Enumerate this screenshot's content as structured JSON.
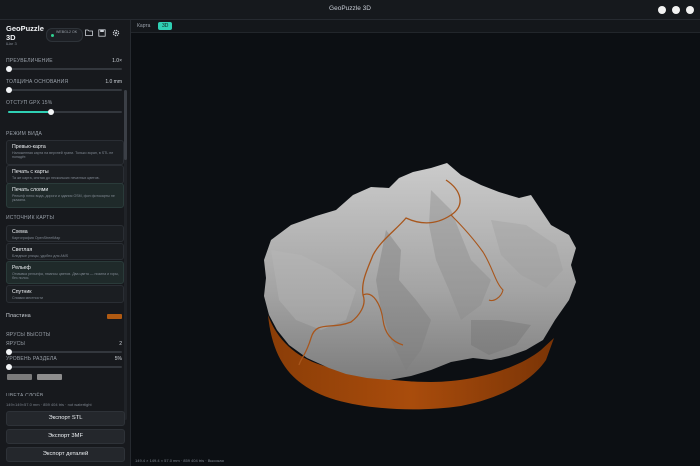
{
  "window": {
    "title": "GeoPuzzle 3D"
  },
  "sidebar": {
    "app_title": "GeoPuzzle 3D",
    "app_subtitle": "Шаг 3",
    "webgl_status": "WEBGL2 OK",
    "toolbar_icons": [
      "folder-icon",
      "save-icon",
      "gear-icon"
    ],
    "exaggeration": {
      "label": "ПРЕУВЕЛИЧЕНИЕ",
      "value": "1.0×",
      "fraction": 0.0
    },
    "base_thickness": {
      "label": "ТОЛЩИНА ОСНОВАНИЯ",
      "value": "1.0 mm",
      "fraction": 0.0
    },
    "gpx_offset": {
      "label": "ОТСТУП GPX 15%",
      "fraction": 0.38
    },
    "view_mode": {
      "label": "РЕЖИМ ВИДА",
      "items": [
        {
          "title": "Превью-карта",
          "desc": "Наложенная карта на верхней грани. Только экран, в STL не попадёт.",
          "active": false
        },
        {
          "title": "Печать с карты",
          "desc": "Та же карта, снятая до нескольких печатных цветов.",
          "active": false
        },
        {
          "title": "Печать слоями",
          "desc": "Рельеф плюс вода, дороги и здания OSM, фон фотокарты не указана.",
          "active": true
        }
      ]
    },
    "map_source": {
      "label": "ИСТОЧНИК КАРТЫ",
      "items": [
        {
          "title": "Схема",
          "desc": "Картография OpenStreetMap",
          "active": false
        },
        {
          "title": "Светлая",
          "desc": "Бледные улицы, удобно для AMS",
          "active": false
        },
        {
          "title": "Рельеф",
          "desc": "Отмывка рельефа, нюансы цветов. Два цвета — низина и горы, без полос.",
          "active": true
        },
        {
          "title": "Спутник",
          "desc": "Снимки местности",
          "active": false
        }
      ]
    },
    "plate": {
      "label": "Пластина",
      "color": "#b05a12"
    },
    "height_tiers": {
      "label": "ЯРУСЫ ВЫСОТЫ",
      "tiers": {
        "label": "ЯРУСЫ",
        "value": "2",
        "fraction": 0.0
      },
      "split_level": {
        "label": "УРОВЕНЬ РАЗДЕЛА",
        "value": "5%",
        "fraction": 0.0
      }
    },
    "layer_colors_label": "ЦВЕТА СЛОЁВ",
    "info": "149×149×57.0 mm · 859 404 tris · not watertight",
    "buttons": {
      "export_stl": "Экспорт STL",
      "export_3mf": "Экспорт 3MF",
      "export_parts": "Экспорт деталей"
    }
  },
  "viewport": {
    "tabs": [
      {
        "label": "Карта",
        "active": false
      },
      {
        "label": "3D",
        "active": true
      }
    ],
    "status": "149.4 × 149.4 × 57.0 mm · 859 404 tris · Высокая"
  },
  "colors": {
    "accent": "#2fd0b4",
    "plate": "#b05a12",
    "terrain": "#a7a7a7",
    "track": "#a8561c"
  }
}
